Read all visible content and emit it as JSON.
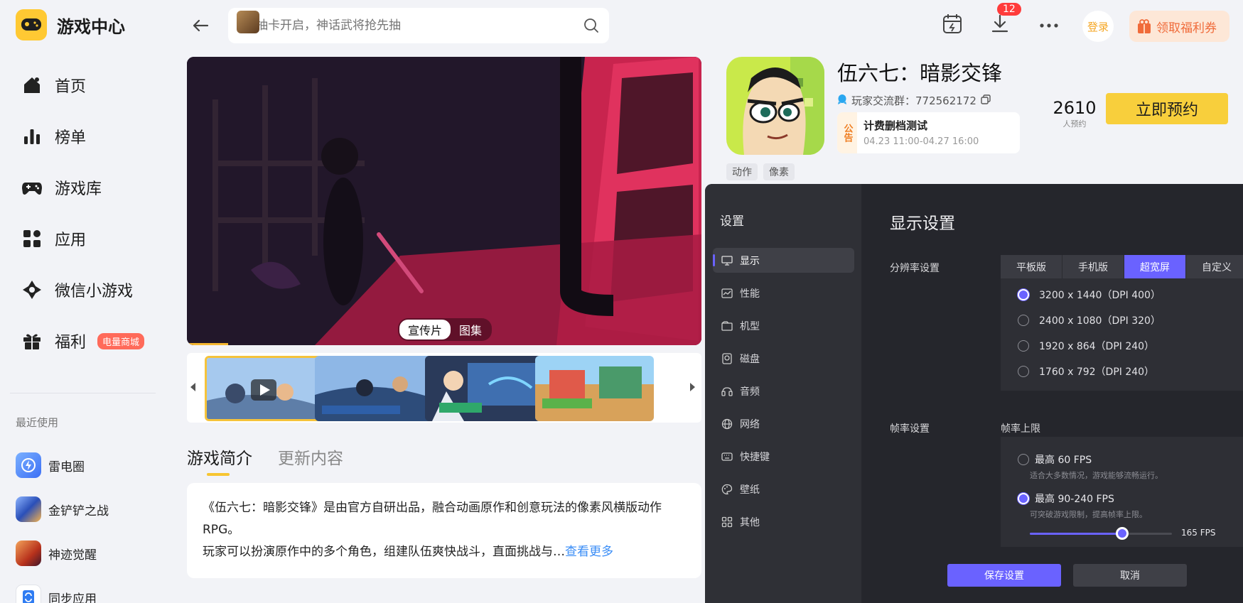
{
  "app": {
    "title": "游戏中心"
  },
  "nav": [
    {
      "label": "首页",
      "icon": "home-icon"
    },
    {
      "label": "榜单",
      "icon": "ranking-icon"
    },
    {
      "label": "游戏库",
      "icon": "gamepad-icon"
    },
    {
      "label": "应用",
      "icon": "apps-icon"
    },
    {
      "label": "微信小游戏",
      "icon": "mini-game-icon"
    },
    {
      "label": "福利",
      "icon": "gift-icon",
      "badge": "电量商城"
    }
  ],
  "recent": {
    "title": "最近使用",
    "items": [
      {
        "label": "雷电圈",
        "color": "#4a8cf7"
      },
      {
        "label": "金铲铲之战",
        "color": "#3b6fd6"
      },
      {
        "label": "神迹觉醒",
        "color": "#c94a2b"
      },
      {
        "label": "同步应用",
        "color": "#2f7cf2"
      }
    ]
  },
  "search": {
    "placeholder": "预抽卡开启，神话武将抢先抽"
  },
  "topbar": {
    "download_count": "12",
    "login": "登录",
    "welfare": "领取福利券"
  },
  "hero": {
    "tabs": [
      "宣传片",
      "图集"
    ]
  },
  "content_tabs": [
    "游戏简介",
    "更新内容"
  ],
  "description": {
    "line1": "《伍六七：暗影交锋》是由官方自研出品，融合动画原作和创意玩法的像素风横版动作RPG。",
    "line2": "玩家可以扮演原作中的多个角色，组建队伍爽快战斗，直面挑战与…",
    "more": "查看更多"
  },
  "game": {
    "title": "伍六七：暗影交锋",
    "group": "玩家交流群：772562172",
    "notice_tag": "公告",
    "notice_title": "计费删档测试",
    "notice_time": "04.23 11:00-04.27 16:00",
    "reserve_count": "2610",
    "reserve_unit": "人预约",
    "reserve_button": "立即预约",
    "tags": [
      "动作",
      "像素"
    ]
  },
  "settings": {
    "title": "设置",
    "menu": [
      {
        "label": "显示",
        "icon": "monitor-icon"
      },
      {
        "label": "性能",
        "icon": "performance-icon"
      },
      {
        "label": "机型",
        "icon": "device-icon"
      },
      {
        "label": "磁盘",
        "icon": "disk-icon"
      },
      {
        "label": "音频",
        "icon": "audio-icon"
      },
      {
        "label": "网络",
        "icon": "network-icon"
      },
      {
        "label": "快捷键",
        "icon": "keyboard-icon"
      },
      {
        "label": "壁纸",
        "icon": "wallpaper-icon"
      },
      {
        "label": "其他",
        "icon": "other-icon"
      }
    ],
    "panel_title": "显示设置",
    "resolution_label": "分辨率设置",
    "resolution_tabs": [
      "平板版",
      "手机版",
      "超宽屏",
      "自定义"
    ],
    "resolution_active": "超宽屏",
    "resolutions": [
      "3200 x 1440（DPI 400）",
      "2400 x 1080（DPI 320）",
      "1920 x 864（DPI 240）",
      "1760 x 792（DPI 240）"
    ],
    "resolution_selected": 0,
    "fps_label": "帧率设置",
    "fps_limit_label": "帧率上限",
    "fps_options": [
      {
        "title": "最高 60 FPS",
        "desc": "适合大多数情况，游戏能够流畅运行。"
      },
      {
        "title": "最高 90-240 FPS",
        "desc": "可突破游戏限制，提高帧率上限。"
      }
    ],
    "fps_selected": 1,
    "fps_value": "165 FPS",
    "fps_slider_fraction": 0.65,
    "save": "保存设置",
    "cancel": "取消",
    "accent": "#6a62ff"
  }
}
